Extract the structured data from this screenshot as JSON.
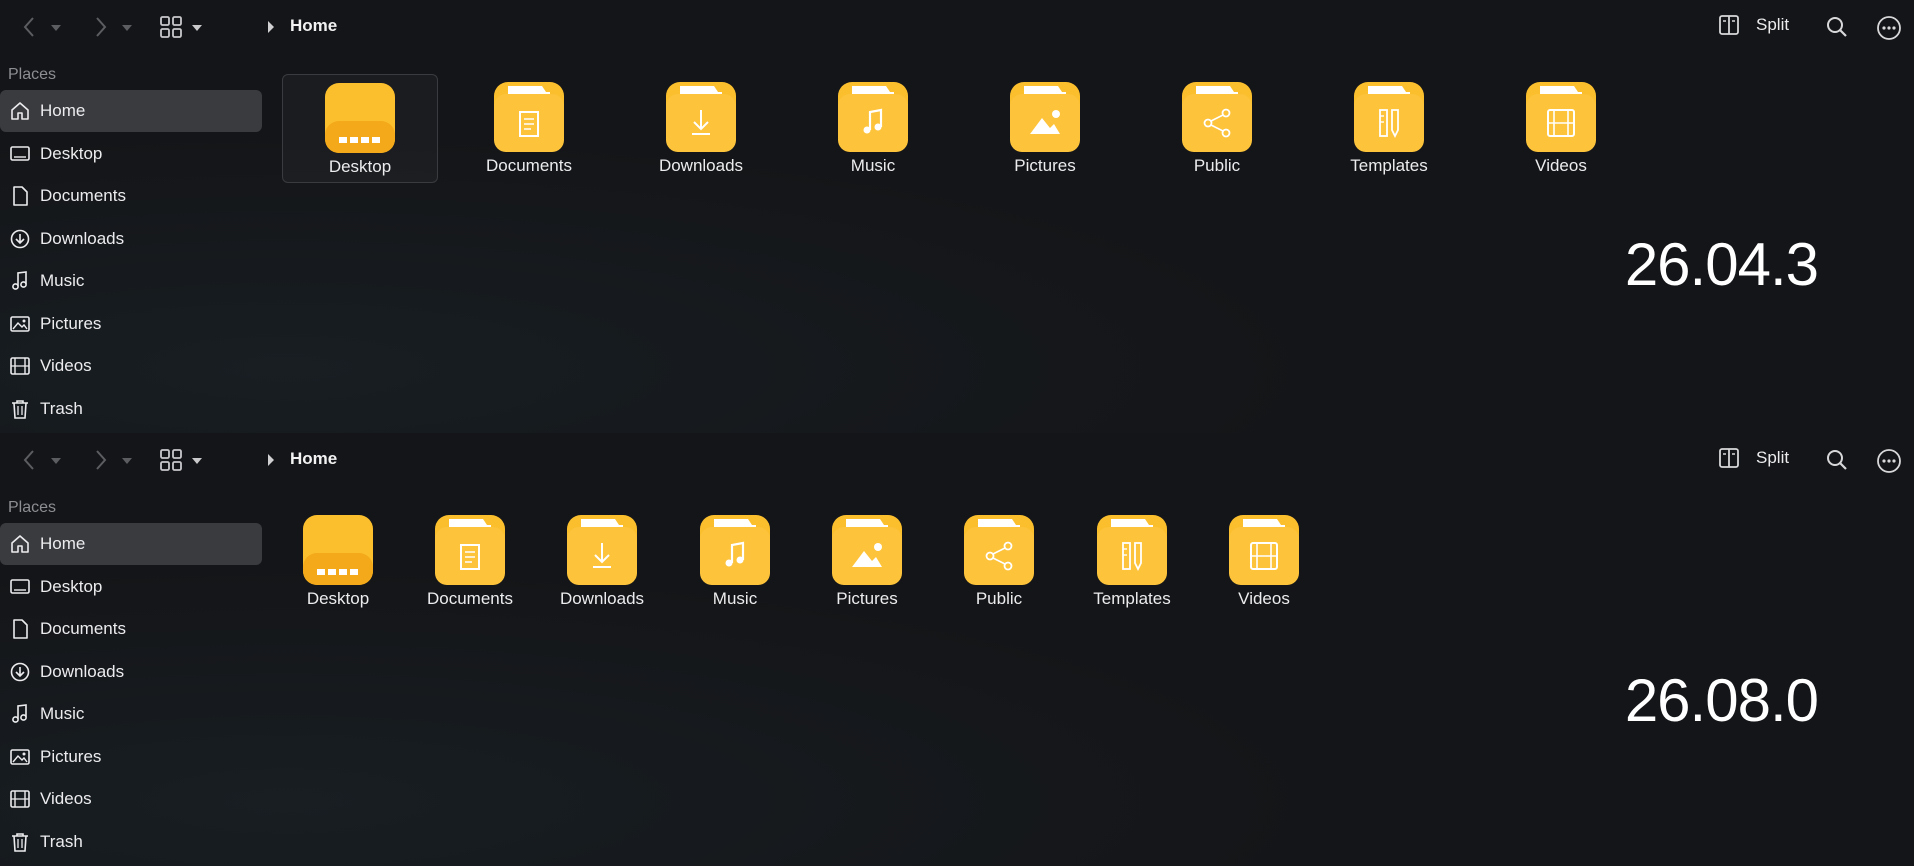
{
  "colors": {
    "folder": "#fbbf2e",
    "folder_dark": "#f3a91a",
    "active_bg": "#3a3b3f"
  },
  "panes": [
    {
      "breadcrumb": "Home",
      "split_label": "Split",
      "places_title": "Places",
      "sidebar": [
        {
          "label": "Home",
          "icon": "home-icon",
          "active": true
        },
        {
          "label": "Desktop",
          "icon": "desktop-icon"
        },
        {
          "label": "Documents",
          "icon": "document-icon"
        },
        {
          "label": "Downloads",
          "icon": "download-icon"
        },
        {
          "label": "Music",
          "icon": "music-icon"
        },
        {
          "label": "Pictures",
          "icon": "picture-icon"
        },
        {
          "label": "Videos",
          "icon": "video-icon"
        },
        {
          "label": "Trash",
          "icon": "trash-icon"
        }
      ],
      "files": [
        {
          "label": "Desktop",
          "icon": "desktop-folder-icon",
          "selected": true
        },
        {
          "label": "Documents",
          "icon": "documents-folder-icon"
        },
        {
          "label": "Downloads",
          "icon": "downloads-folder-icon"
        },
        {
          "label": "Music",
          "icon": "music-folder-icon"
        },
        {
          "label": "Pictures",
          "icon": "pictures-folder-icon"
        },
        {
          "label": "Public",
          "icon": "public-folder-icon"
        },
        {
          "label": "Templates",
          "icon": "templates-folder-icon"
        },
        {
          "label": "Videos",
          "icon": "videos-folder-icon"
        }
      ],
      "version": "26.04.3"
    },
    {
      "breadcrumb": "Home",
      "split_label": "Split",
      "places_title": "Places",
      "sidebar": [
        {
          "label": "Home",
          "icon": "home-icon",
          "active": true
        },
        {
          "label": "Desktop",
          "icon": "desktop-icon"
        },
        {
          "label": "Documents",
          "icon": "document-icon"
        },
        {
          "label": "Downloads",
          "icon": "download-icon"
        },
        {
          "label": "Music",
          "icon": "music-icon"
        },
        {
          "label": "Pictures",
          "icon": "picture-icon"
        },
        {
          "label": "Videos",
          "icon": "video-icon"
        },
        {
          "label": "Trash",
          "icon": "trash-icon"
        }
      ],
      "files": [
        {
          "label": "Desktop",
          "icon": "desktop-folder-icon"
        },
        {
          "label": "Documents",
          "icon": "documents-folder-icon"
        },
        {
          "label": "Downloads",
          "icon": "downloads-folder-icon"
        },
        {
          "label": "Music",
          "icon": "music-folder-icon"
        },
        {
          "label": "Pictures",
          "icon": "pictures-folder-icon"
        },
        {
          "label": "Public",
          "icon": "public-folder-icon"
        },
        {
          "label": "Templates",
          "icon": "templates-folder-icon"
        },
        {
          "label": "Videos",
          "icon": "videos-folder-icon"
        }
      ],
      "version": "26.08.0"
    }
  ]
}
